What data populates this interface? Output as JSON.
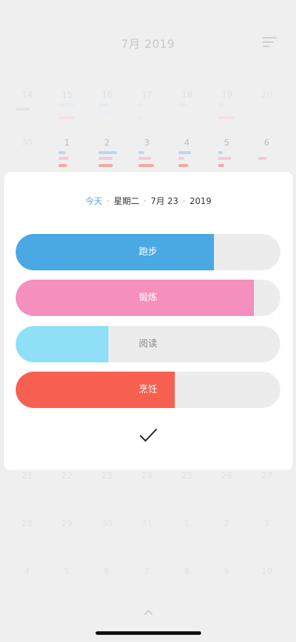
{
  "header": {
    "title": "7月 2019"
  },
  "calendar": {
    "rows": [
      {
        "days": [
          "30",
          "1",
          "2",
          "3",
          "4",
          "5",
          "6"
        ],
        "faded": true
      },
      {
        "days": [
          "30",
          "1",
          "2",
          "3",
          "4",
          "5",
          "6"
        ],
        "faded": false
      },
      {
        "days": [
          "14",
          "15",
          "16",
          "17",
          "18",
          "19",
          "20"
        ],
        "faded": true
      },
      {
        "days": [
          "21",
          "22",
          "23",
          "24",
          "25",
          "26",
          "27"
        ],
        "faded": true
      },
      {
        "days": [
          "28",
          "29",
          "30",
          "31",
          "1",
          "2",
          "3"
        ],
        "faded": true
      },
      {
        "days": [
          "4",
          "5",
          "6",
          "7",
          "8",
          "9",
          "10"
        ],
        "faded": true
      }
    ]
  },
  "sheet": {
    "date": {
      "today": "今天",
      "weekday": "星期二",
      "date": "7月 23",
      "year": "2019",
      "separator": "·"
    },
    "activities": [
      {
        "label": "跑步",
        "color": "#4aa8e2",
        "progress": 0.75
      },
      {
        "label": "锻炼",
        "color": "#f58fbd",
        "progress": 0.9
      },
      {
        "label": "阅读",
        "color": "#8fe0f7",
        "progress": 0.35
      },
      {
        "label": "烹饪",
        "color": "#f76050",
        "progress": 0.6
      }
    ]
  },
  "colors": {
    "accent": "#4ea8e4",
    "background": "#efefef"
  },
  "icons": {
    "menu": "menu-icon",
    "confirm": "check-icon",
    "expand": "chevron-up-icon"
  }
}
